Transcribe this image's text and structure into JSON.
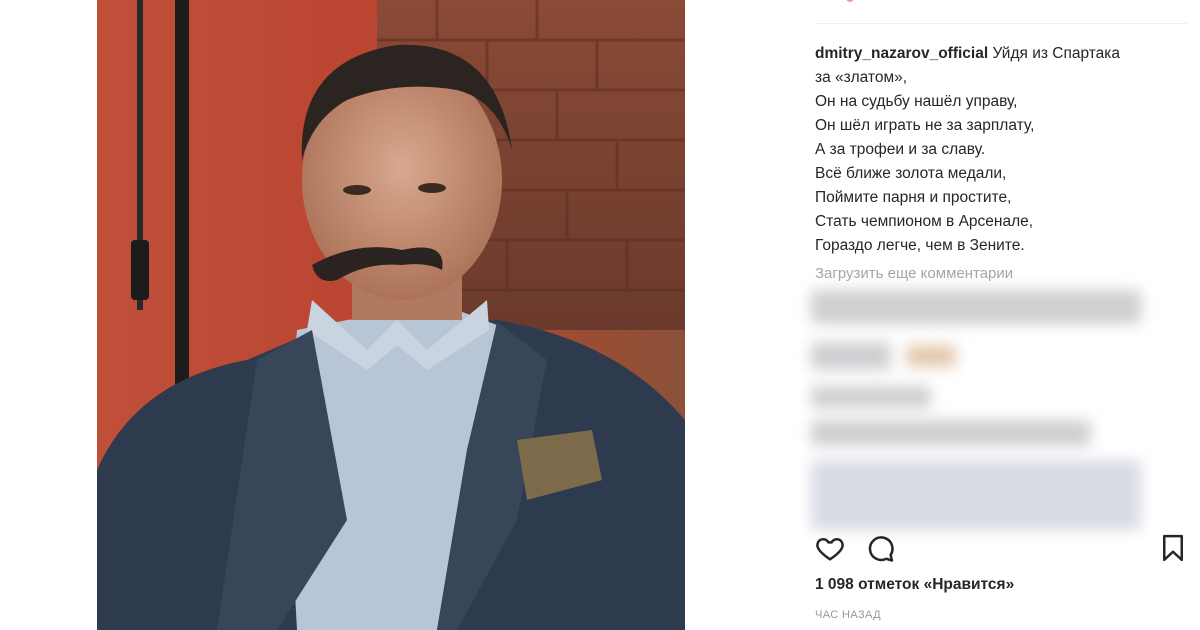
{
  "post": {
    "username": "dmitry_nazarov_official",
    "caption_first": "Уйдя из Спартака",
    "caption_lines": [
      "за «златом»,",
      "Он на судьбу нашёл управу,",
      "Он шёл играть не за зарплату,",
      "А за трофеи и за славу.",
      "Всё ближе золота медали,",
      "Поймите парня и простите,",
      "Стать чемпионом в Арсенале,",
      "Гораздо легче, чем в Зените."
    ],
    "load_more_comments": "Загрузить еще комментарии",
    "likes": "1 098 отметок «Нравится»",
    "time": "час назад"
  },
  "icons": {
    "like": "heart-icon",
    "comment": "comment-icon",
    "save": "bookmark-icon"
  },
  "colors": {
    "text": "#262626",
    "muted": "#a5a5a5"
  }
}
